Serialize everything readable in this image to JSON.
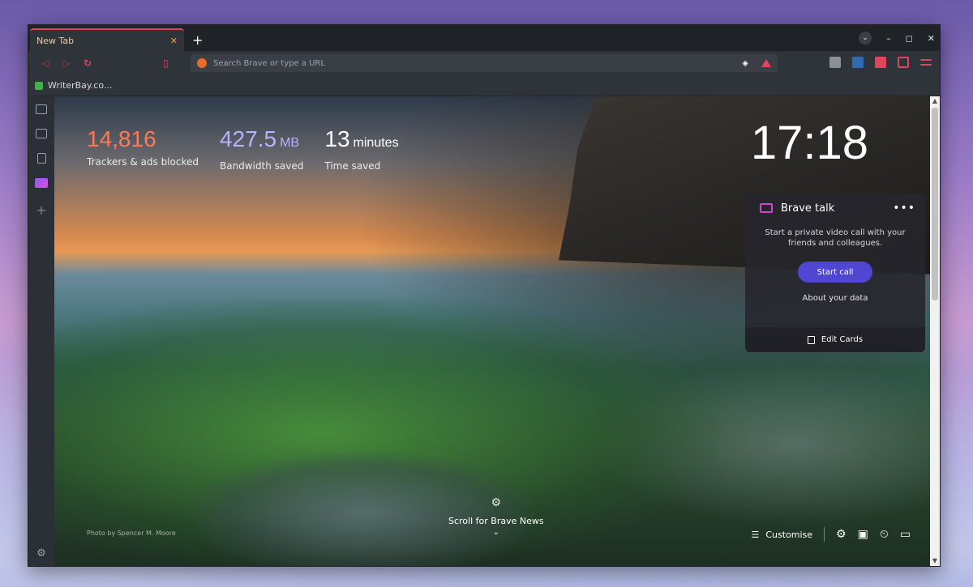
{
  "tab": {
    "title": "New Tab",
    "close": "✕",
    "new_tab": "+"
  },
  "window_controls": {
    "menu": "⌄",
    "minimize": "–",
    "maximize": "◻",
    "close": "✕"
  },
  "omnibox": {
    "placeholder": "Search Brave or type a URL"
  },
  "bookmarks": [
    {
      "label": "WriterBay.co..."
    }
  ],
  "stats": {
    "trackers": {
      "value": "14,816",
      "label": "Trackers & ads blocked"
    },
    "bandwidth": {
      "value": "427.5",
      "unit": "MB",
      "label": "Bandwidth saved"
    },
    "time": {
      "value": "13",
      "unit": "minutes",
      "label": "Time saved"
    }
  },
  "clock": "17:18",
  "brave_talk": {
    "title": "Brave talk",
    "more": "•••",
    "description": "Start a private video call with your friends and colleagues.",
    "start_button": "Start call",
    "about_link": "About your data",
    "edit_cards": "Edit Cards"
  },
  "photo_credit": "Photo by Spencer M. Moore",
  "news": {
    "label": "Scroll for Brave News"
  },
  "customise": "Customise",
  "colors": {
    "accent": "#e0465b",
    "trackers": "#ff7a52",
    "bandwidth": "#b7b3ff",
    "start_call": "#4f46d4"
  },
  "icons": {
    "back": "◁",
    "forward": "▷",
    "reload": "↻",
    "bookmark": "▯",
    "lion": "◈",
    "settings": "⚙",
    "chevron": "⌄",
    "customise": "☰",
    "history": "⏲",
    "video": "▭",
    "save": "▣"
  }
}
